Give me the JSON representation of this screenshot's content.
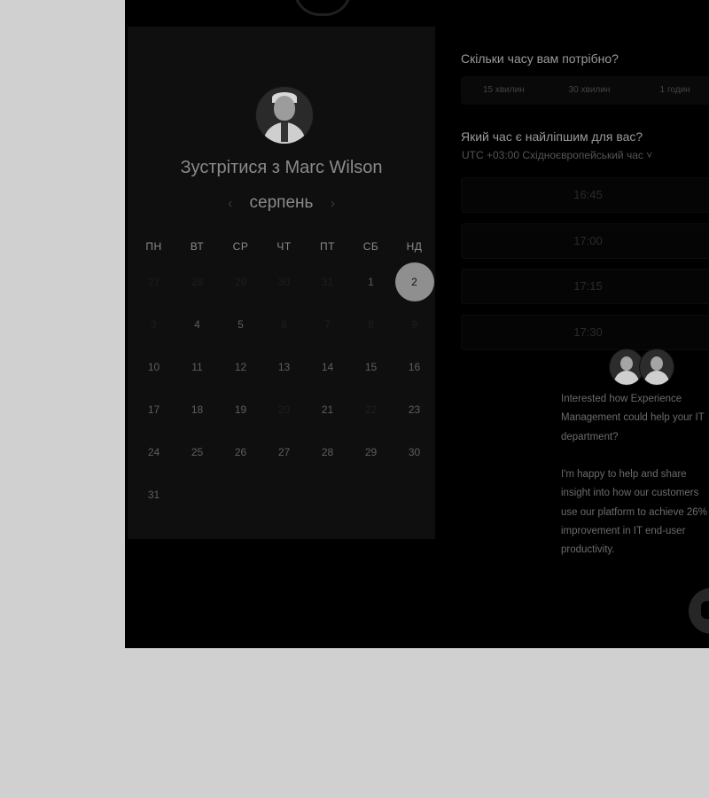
{
  "calendar": {
    "title": "Зустрітися з Marc Wilson",
    "month": "серпень",
    "prev_icon": "‹",
    "next_icon": "›",
    "weekdays": [
      "ПН",
      "ВТ",
      "СР",
      "ЧТ",
      "ПТ",
      "СБ",
      "НД"
    ],
    "weeks": [
      [
        {
          "d": "27",
          "m": true
        },
        {
          "d": "28",
          "m": true
        },
        {
          "d": "29",
          "m": true
        },
        {
          "d": "30",
          "m": true
        },
        {
          "d": "31",
          "m": true
        },
        {
          "d": "1"
        },
        {
          "d": "2",
          "sel": true
        }
      ],
      [
        {
          "d": "3",
          "m": true
        },
        {
          "d": "4"
        },
        {
          "d": "5"
        },
        {
          "d": "6",
          "m": true
        },
        {
          "d": "7",
          "m": true
        },
        {
          "d": "8",
          "m": true
        },
        {
          "d": "9",
          "m": true
        }
      ],
      [
        {
          "d": "10"
        },
        {
          "d": "11"
        },
        {
          "d": "12"
        },
        {
          "d": "13"
        },
        {
          "d": "14"
        },
        {
          "d": "15"
        },
        {
          "d": "16"
        }
      ],
      [
        {
          "d": "17"
        },
        {
          "d": "18"
        },
        {
          "d": "19"
        },
        {
          "d": "20",
          "m": true
        },
        {
          "d": "21"
        },
        {
          "d": "22",
          "m": true
        },
        {
          "d": "23"
        }
      ],
      [
        {
          "d": "24"
        },
        {
          "d": "25"
        },
        {
          "d": "26"
        },
        {
          "d": "27"
        },
        {
          "d": "28"
        },
        {
          "d": "29"
        },
        {
          "d": "30"
        }
      ],
      [
        {
          "d": "31"
        },
        {
          "d": "",
          "m": true
        },
        {
          "d": "",
          "m": true
        },
        {
          "d": "",
          "m": true
        },
        {
          "d": "",
          "m": true
        },
        {
          "d": "",
          "m": true
        },
        {
          "d": "",
          "m": true
        }
      ]
    ]
  },
  "duration": {
    "question": "Скільки часу вам потрібно?",
    "options": [
      "15 хвилин",
      "30 хвилин",
      "1 годин"
    ]
  },
  "time": {
    "question": "Який час є найліпшим для вас?",
    "timezone": "UTC +03:00 Східноєвропейський час ˅",
    "slots": [
      "16:45",
      "17:00",
      "17:15",
      "17:30"
    ]
  },
  "chat": {
    "message_1": "Interested how Experience Management could help your IT department?",
    "message_2": "I'm happy to help and share insight into how our customers use our platform to achieve 26% improvement in IT end-user productivity."
  }
}
